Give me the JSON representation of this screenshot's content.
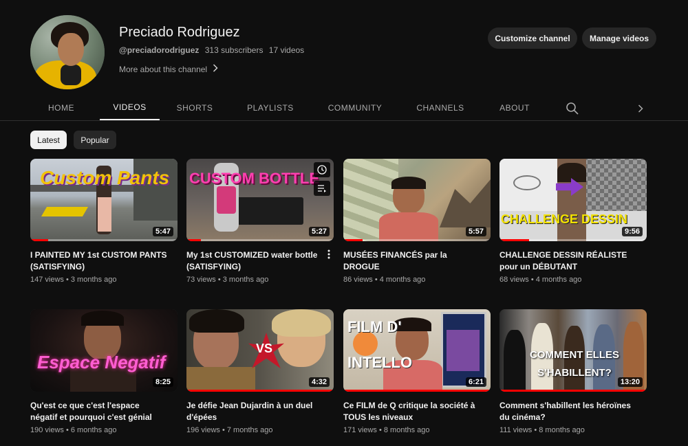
{
  "channel": {
    "name": "Preciado Rodriguez",
    "handle": "@preciadorodriguez",
    "subscribers": "313 subscribers",
    "videos_count": "17 videos",
    "more_about": "More about this channel"
  },
  "actions": {
    "customize": "Customize channel",
    "manage": "Manage videos"
  },
  "tabs": [
    {
      "label": "HOME"
    },
    {
      "label": "VIDEOS",
      "active": true
    },
    {
      "label": "SHORTS"
    },
    {
      "label": "PLAYLISTS"
    },
    {
      "label": "COMMUNITY"
    },
    {
      "label": "CHANNELS"
    },
    {
      "label": "ABOUT"
    }
  ],
  "chips": {
    "latest": "Latest",
    "popular": "Popular"
  },
  "videos": [
    {
      "title": "I PAINTED MY 1st CUSTOM PANTS (SATISFYING)",
      "stats": "147 views • 3 months ago",
      "duration": "5:47",
      "overlay": "Custom Pants",
      "watched": 0.12
    },
    {
      "title": "My 1st CUSTOMIZED water bottle (SATISFYING)",
      "stats": "73 views • 3 months ago",
      "duration": "5:27",
      "overlay": "CUSTOM BOTTLE",
      "watched": 0.1
    },
    {
      "title": "MUSÉES FINANCÉS par la DROGUE",
      "stats": "86 views • 4 months ago",
      "duration": "5:57",
      "overlay": "",
      "watched": 0.13
    },
    {
      "title": "CHALLENGE DESSIN RÉALISTE pour un DÉBUTANT",
      "stats": "68 views • 4 months ago",
      "duration": "9:56",
      "overlay": "CHALLENGE DESSIN",
      "watched": 0.2
    },
    {
      "title": "Qu'est ce que c'est l'espace négatif et pourquoi c'est génial",
      "stats": "190 views • 6 months ago",
      "duration": "8:25",
      "overlay": "Espace Negatif",
      "watched": 0.0
    },
    {
      "title": "Je défie Jean Dujardin à un duel d'épées",
      "stats": "196 views • 7 months ago",
      "duration": "4:32",
      "overlay": "VS",
      "watched": 1.0
    },
    {
      "title": "Ce FILM de Q critique la société à TOUS les niveaux",
      "stats": "171 views • 8 months ago",
      "duration": "6:21",
      "overlay": "FILM D' INTELLO",
      "watched": 1.0
    },
    {
      "title": "Comment s'habillent les héroïnes du cinéma?",
      "stats": "111 views • 8 months ago",
      "duration": "13:20",
      "overlay": "COMMENT ELLES S'HABILLENT?",
      "watched": 1.0
    }
  ],
  "icons": {
    "search": "search-icon",
    "next": "chevron-right-icon",
    "more": "chevron-right-icon",
    "watch_later": "clock-icon",
    "add_queue": "queue-icon",
    "menu": "kebab-menu-icon"
  }
}
